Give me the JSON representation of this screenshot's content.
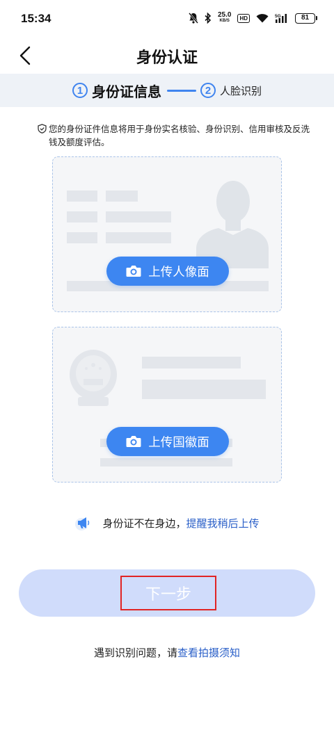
{
  "status_bar": {
    "time": "15:34",
    "net_speed_value": "25.0",
    "net_speed_unit": "KB/S",
    "hd_label": "HD",
    "network": "5G",
    "battery": "81"
  },
  "nav": {
    "title": "身份认证"
  },
  "steps": [
    {
      "number": "1",
      "label": "身份证信息",
      "active": true
    },
    {
      "number": "2",
      "label": "人脸识别",
      "active": false
    }
  ],
  "notice": {
    "text": "您的身份证件信息将用于身份实名核验、身份识别、信用审核及反洗钱及额度评估。",
    "icon": "shield-check-icon"
  },
  "cards": {
    "front_button": "上传人像面",
    "back_button": "上传国徽面"
  },
  "reminder": {
    "prefix": "身份证不在身边，",
    "link": "提醒我稍后上传",
    "icon": "megaphone-icon"
  },
  "next_button": {
    "label": "下一步"
  },
  "help": {
    "prefix": "遇到识别问题，请",
    "link": "查看拍摄须知"
  },
  "colors": {
    "primary": "#3d86f1",
    "link": "#2a5fc8",
    "disabled_button": "#d0dcfb",
    "highlight_box": "#e12424"
  }
}
